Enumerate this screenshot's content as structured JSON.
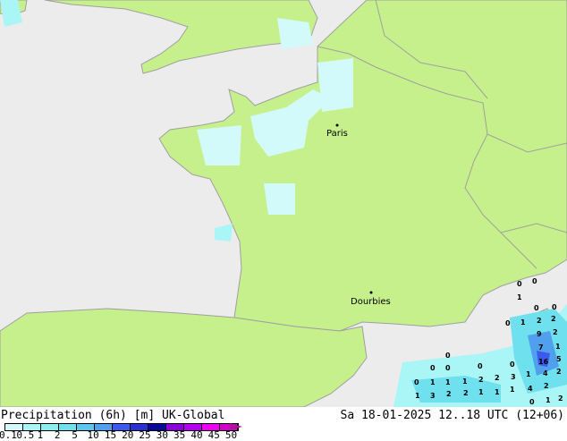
{
  "map": {
    "cities": [
      {
        "name": "Paris"
      },
      {
        "name": "Dourbies"
      }
    ],
    "values": [
      "0",
      "0",
      "1",
      "0",
      "0",
      "0",
      "1",
      "2",
      "2",
      "9",
      "2",
      "7",
      "1",
      "16",
      "5",
      "1",
      "4",
      "2",
      "0",
      "0",
      "0",
      "0",
      "0",
      "0",
      "1",
      "1",
      "1",
      "2",
      "2",
      "3",
      "1",
      "3",
      "2",
      "2",
      "1",
      "1",
      "1",
      "4",
      "2",
      "0",
      "1",
      "2"
    ],
    "colors": {
      "land": "#c6f08c",
      "sea": "#ececec",
      "border": "#a0a0a0"
    }
  },
  "footer": {
    "title": "Precipitation (6h) [m] UK-Global",
    "datetime": "Sa 18-01-2025 12..18 UTC (12+06)",
    "legend_ticks": [
      "0.1",
      "0.5",
      "1",
      "2",
      "5",
      "10",
      "15",
      "20",
      "25",
      "30",
      "35",
      "40",
      "45",
      "50"
    ],
    "legend_colors": [
      "#d2fafa",
      "#aaf5f5",
      "#8ceeee",
      "#6ee0ee",
      "#5ac8ee",
      "#50a0ee",
      "#3c5aee",
      "#2832d2",
      "#0a0a96",
      "#8c00dc",
      "#b400f0",
      "#f000f0",
      "#d200c8",
      "#b4009a"
    ]
  }
}
